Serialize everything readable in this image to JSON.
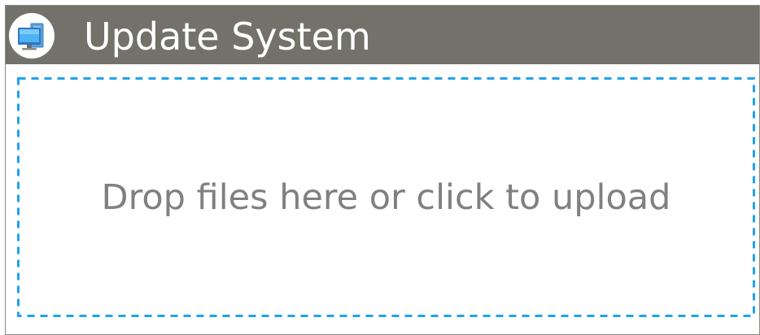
{
  "window": {
    "title": "Update System",
    "icon": "computer-monitor-icon"
  },
  "dropzone": {
    "message": "Drop files here or click to upload",
    "border_color": "#1fa3ee"
  },
  "colors": {
    "title_bar": "#72726b",
    "title_text": "#ffffff",
    "message_text": "#808080"
  }
}
